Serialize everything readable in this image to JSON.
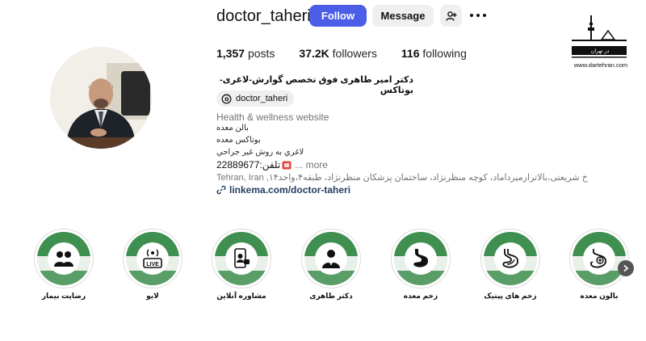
{
  "profile": {
    "username": "doctor_taheri",
    "follow_label": "Follow",
    "message_label": "Message",
    "stats": {
      "posts_count": "1,357",
      "posts_label": "posts",
      "followers_count": "37.2K",
      "followers_label": "followers",
      "following_count": "116",
      "following_label": "following"
    },
    "full_name": "دکتر امیر طاهری فوق تخصص گوارش-لاغری-بوتاکس",
    "threads_handle": "doctor_taheri",
    "category": "Health & wellness website",
    "bio_lines": [
      "بالن معده",
      "بوتاکس معده",
      "لاغري به روش غير جراحي"
    ],
    "phone_text": "تلفن:22889677",
    "more_label": "... more",
    "address": "Tehran, Iran ,خ شریعتی،بالاترازمیرداماد، کوچه منظرنژاد، ساختمان پزشکان منظرنژاد، طبقه۴،واحد۱۴",
    "link": "linkema.com/doctor-taheri"
  },
  "watermark": {
    "brand": "در تهران",
    "url": "www.dartehran.com"
  },
  "highlights": [
    {
      "label": "رضایت بیمار",
      "icon": "people-icon"
    },
    {
      "label": "لایو",
      "icon": "live-icon"
    },
    {
      "label": "مشاوره آنلاین",
      "icon": "phone-consult-icon"
    },
    {
      "label": "دکتر طاهری",
      "icon": "doctor-icon"
    },
    {
      "label": "زخم معده",
      "icon": "stomach-icon"
    },
    {
      "label": "زخم های پپتیک",
      "icon": "stomach-ulcer-icon"
    },
    {
      "label": "بالون معده",
      "icon": "balloon-icon"
    }
  ],
  "colors": {
    "follow_button": "#4c5ee8",
    "link": "#243e63",
    "highlight_green": "#3f8f50"
  }
}
